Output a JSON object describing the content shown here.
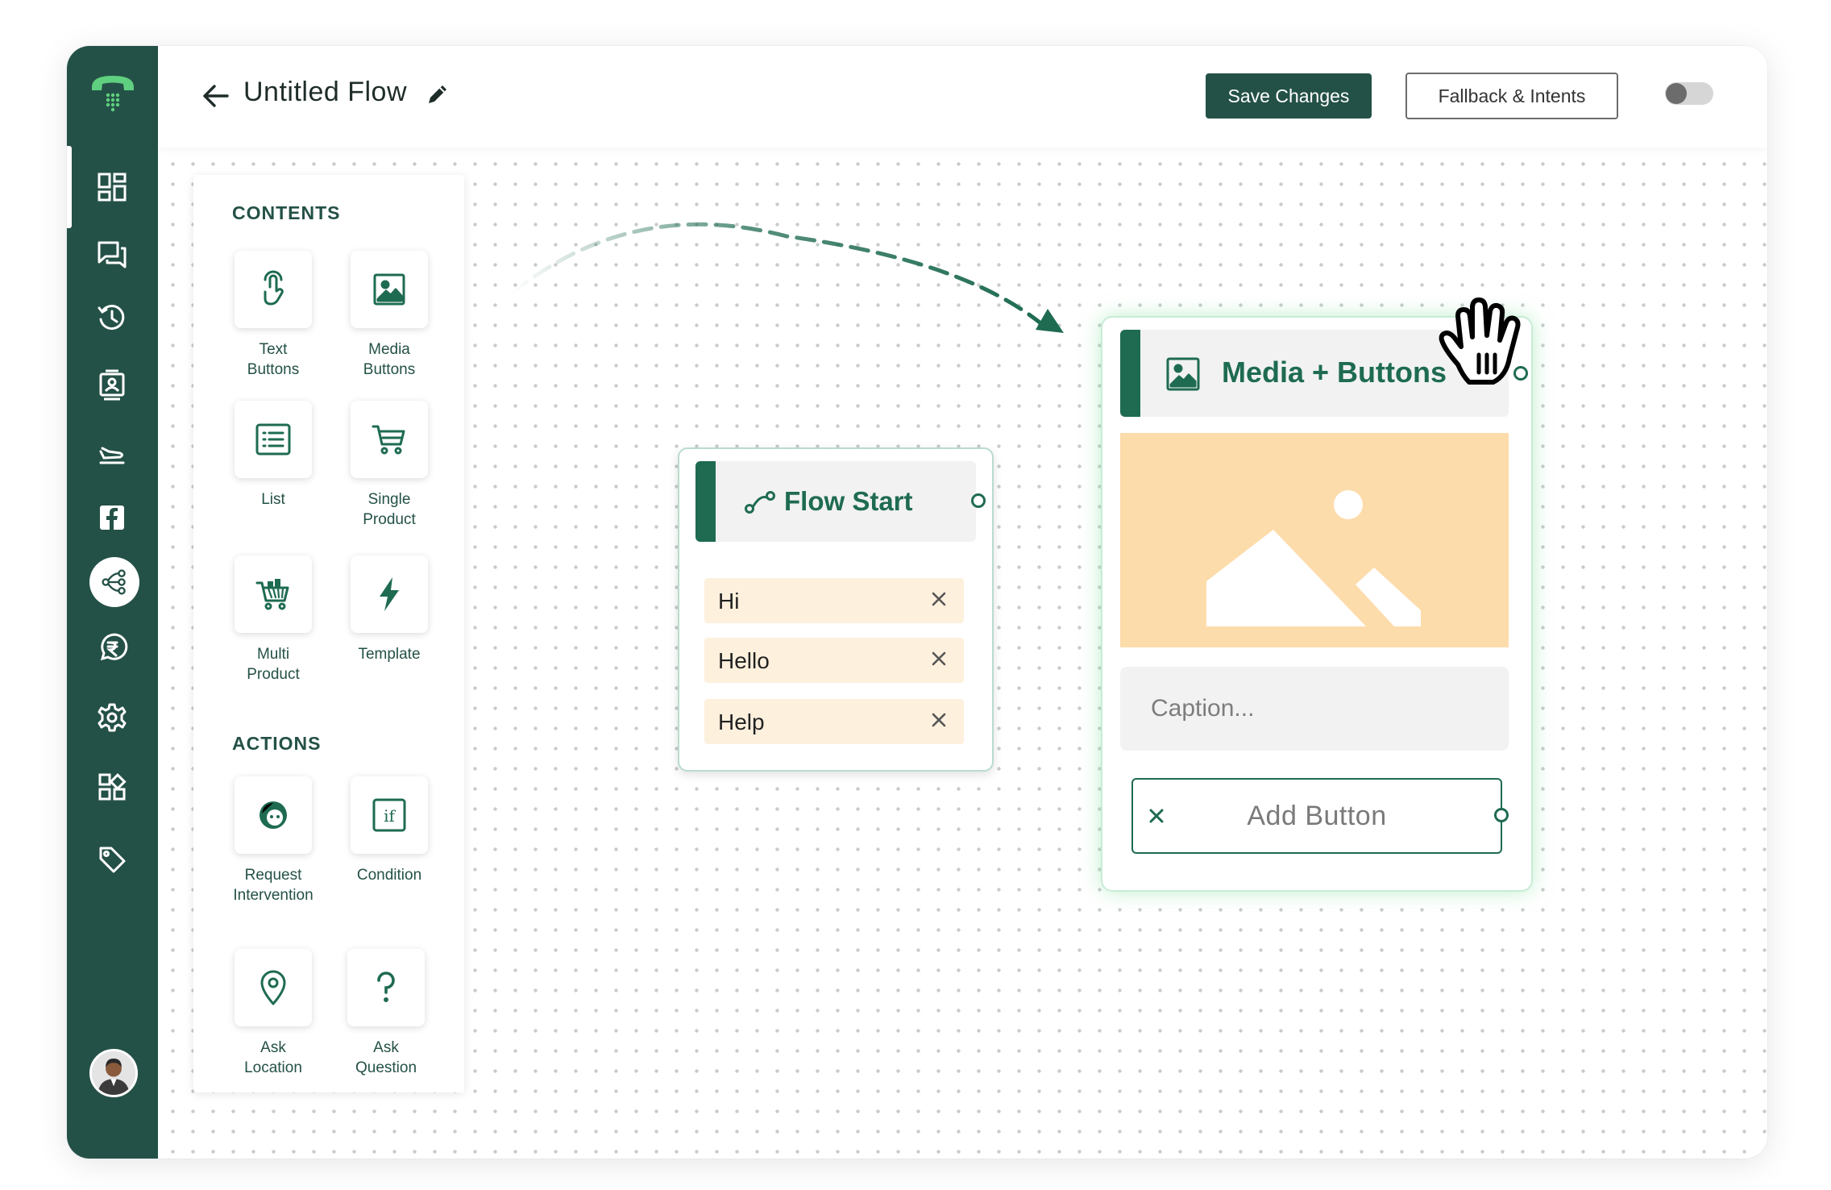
{
  "header": {
    "title": "Untitled Flow",
    "save_label": "Save Changes",
    "fallback_label": "Fallback & Intents",
    "toggle_on": false
  },
  "sidebar": {
    "items": [
      {
        "name": "dashboard",
        "icon": "dashboard-grid-icon",
        "active": true
      },
      {
        "name": "chats",
        "icon": "chat-bubbles-icon"
      },
      {
        "name": "history",
        "icon": "history-clock-icon"
      },
      {
        "name": "contacts",
        "icon": "contact-card-icon"
      },
      {
        "name": "campaigns",
        "icon": "send-plane-icon"
      },
      {
        "name": "facebook",
        "icon": "facebook-icon"
      },
      {
        "name": "flows",
        "icon": "flow-nodes-icon",
        "selected": true
      },
      {
        "name": "payments",
        "icon": "rupee-chat-icon"
      },
      {
        "name": "settings",
        "icon": "gear-icon"
      },
      {
        "name": "integrations",
        "icon": "apps-icon"
      },
      {
        "name": "tags",
        "icon": "tag-icon"
      }
    ]
  },
  "palette": {
    "contents_title": "CONTENTS",
    "actions_title": "ACTIONS",
    "contents": [
      {
        "label": "Text\nButtons",
        "icon": "tap-finger-icon"
      },
      {
        "label": "Media\nButtons",
        "icon": "image-icon"
      },
      {
        "label": "List",
        "icon": "list-icon"
      },
      {
        "label": "Single\nProduct",
        "icon": "cart-icon"
      },
      {
        "label": "Multi\nProduct",
        "icon": "full-cart-icon"
      },
      {
        "label": "Template",
        "icon": "lightning-icon"
      }
    ],
    "actions": [
      {
        "label": "Request\nIntervention",
        "icon": "agent-face-icon"
      },
      {
        "label": "Condition",
        "icon": "if-condition-icon"
      },
      {
        "label": "Ask\nLocation",
        "icon": "location-pin-icon"
      },
      {
        "label": "Ask\nQuestion",
        "icon": "question-mark-icon"
      }
    ]
  },
  "flow_start": {
    "title": "Flow Start",
    "keywords": [
      "Hi",
      "Hello",
      "Help"
    ]
  },
  "media_node": {
    "title": "Media + Buttons",
    "caption_placeholder": "Caption...",
    "add_button_label": "Add Button"
  },
  "colors": {
    "brand": "#245147",
    "accent": "#1e6b52",
    "keyword_bg": "#fdf0dd",
    "media_placeholder": "#fddcab"
  }
}
